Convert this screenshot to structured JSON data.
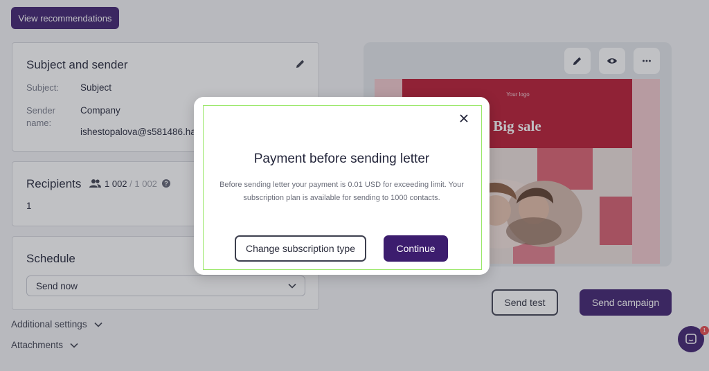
{
  "header": {
    "recommendations_label": "View recommendations"
  },
  "subject_card": {
    "title": "Subject and sender",
    "subject_label": "Subject:",
    "subject_value": "Subject",
    "sender_label": "Sender name:",
    "sender_value": "Company",
    "sender_email": "ishestopalova@s581486.ha"
  },
  "recipients_card": {
    "title": "Recipients",
    "count": "1 002",
    "total": " / 1 002",
    "help": "?",
    "list_value": "1"
  },
  "schedule_card": {
    "title": "Schedule",
    "select_value": "Send now"
  },
  "sections": {
    "additional_settings": "Additional settings",
    "attachments": "Attachments"
  },
  "preview": {
    "logo_text": "Your logo",
    "headline": "Big sale"
  },
  "actions": {
    "send_test": "Send test",
    "send_campaign": "Send campaign"
  },
  "chat": {
    "badge_count": "1"
  },
  "modal": {
    "title": "Payment before sending letter",
    "message": "Before sending letter your payment is 0.01 USD for exceeding limit. Your subscription plan is available for sending to 1000 contacts.",
    "change_subscription_label": "Change subscription type",
    "continue_label": "Continue"
  },
  "colors": {
    "brand_purple": "#3c1d6e",
    "banner_red": "#b9162f",
    "badge_red": "#e7484a"
  }
}
